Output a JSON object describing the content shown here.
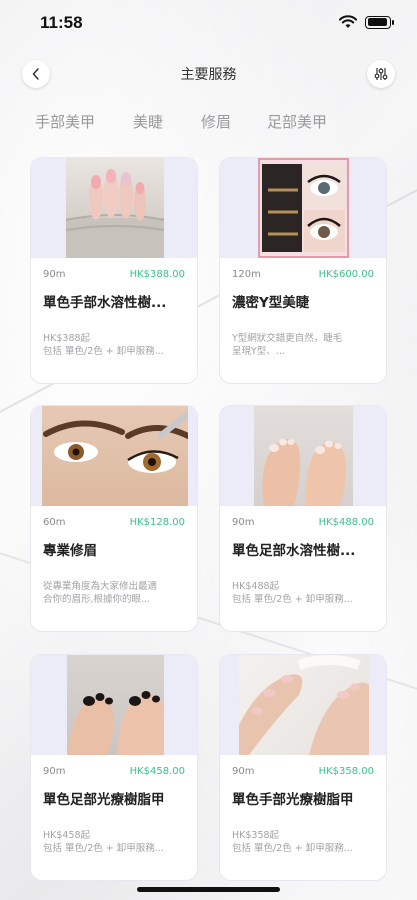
{
  "status_bar": {
    "time": "11:58"
  },
  "nav": {
    "title": "主要服務"
  },
  "tabs": [
    "手部美甲",
    "美睫",
    "修眉",
    "足部美甲"
  ],
  "services": [
    {
      "duration": "90m",
      "price": "HK$388.00",
      "title": "單色手部水溶性樹...",
      "desc_line1": "HK$388起",
      "desc_line2": "包括 單色/2色 + 卸甲服務..."
    },
    {
      "duration": "120m",
      "price": "HK$600.00",
      "title": "濃密Y型美睫",
      "desc_line1": "Y型網狀交錯更自然，睫毛",
      "desc_line2": "呈現Y型、..."
    },
    {
      "duration": "60m",
      "price": "HK$128.00",
      "title": "專業修眉",
      "desc_line1": "從專業角度為大家修出最適",
      "desc_line2": "合你的眉形,根據你的眼..."
    },
    {
      "duration": "90m",
      "price": "HK$488.00",
      "title": "單色足部水溶性樹...",
      "desc_line1": "HK$488起",
      "desc_line2": "包括 單色/2色 + 卸甲服務..."
    },
    {
      "duration": "90m",
      "price": "HK$458.00",
      "title": "單色足部光療樹脂甲",
      "desc_line1": "HK$458起",
      "desc_line2": "包括 單色/2色 + 卸甲服務..."
    },
    {
      "duration": "90m",
      "price": "HK$358.00",
      "title": "單色手部光療樹脂甲",
      "desc_line1": "HK$358起",
      "desc_line2": "包括 單色/2色 + 卸甲服務..."
    }
  ],
  "colors": {
    "price_green": "#3cc08a",
    "image_bg": "#ececf8"
  }
}
